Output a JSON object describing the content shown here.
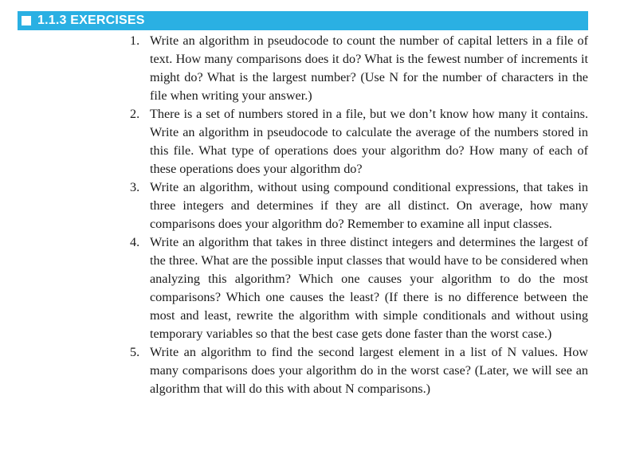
{
  "section": {
    "title": "1.1.3 EXERCISES",
    "accent_color": "#2ab0e3"
  },
  "exercises": [
    {
      "number": "1.",
      "text": "Write an algorithm in pseudocode to count the number of capital letters in a file of text. How many comparisons does it do? What is the fewest number of increments it might do? What is the largest number? (Use N for the number of characters in the file when writing your answer.)"
    },
    {
      "number": "2.",
      "text": "There is a set of numbers stored in a file, but we don’t know how many it contains. Write an algorithm in pseudocode to calculate the average of the numbers stored in this file. What type of operations does your algorithm do? How many of each of these operations does your algorithm do?"
    },
    {
      "number": "3.",
      "text": "Write an algorithm, without using compound conditional expressions, that takes in three integers and determines if they are all distinct. On average, how many comparisons does your algorithm do? Remember to examine all input classes."
    },
    {
      "number": "4.",
      "text": "Write an algorithm that takes in three distinct integers and determines the largest of the three. What are the possible input classes that would have to be considered when analyzing this algorithm? Which one causes your algorithm to do the most comparisons? Which one causes the least? (If there is no difference between the most and least, rewrite the algorithm with simple conditionals and without using temporary variables so that the best case gets done faster than the worst case.)"
    },
    {
      "number": "5.",
      "text": "Write an algorithm to find the second largest element in a list of N values. How many comparisons does your algorithm do in the worst case? (Later, we will see an algorithm that will do this with about N comparisons.)"
    }
  ]
}
